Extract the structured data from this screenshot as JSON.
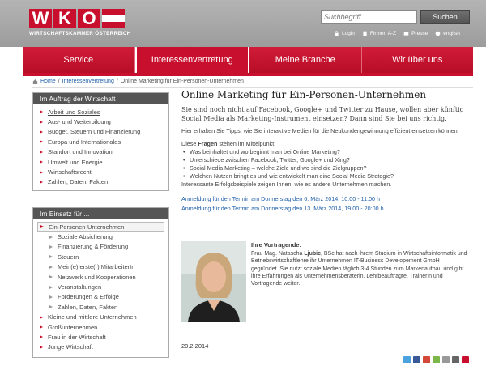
{
  "header": {
    "logo_letters": [
      "W",
      "K",
      "O"
    ],
    "logo_subtitle": "WIRTSCHAFTSKAMMER ÖSTERREICH",
    "search_placeholder": "Suchbegriff",
    "search_button": "Suchen",
    "util_links": [
      {
        "label": "Login",
        "icon": "lock-icon"
      },
      {
        "label": "Firmen A-Z",
        "icon": "building-icon"
      },
      {
        "label": "Presse",
        "icon": "newspaper-icon"
      },
      {
        "label": "english",
        "icon": "globe-icon"
      }
    ],
    "colors": {
      "brand_red": "#c8102e",
      "header_grey": "#a8a8a8"
    }
  },
  "nav": {
    "items": [
      "Service",
      "Interessenvertretung",
      "Meine Branche",
      "Wir über uns"
    ],
    "active_index": 1
  },
  "breadcrumb": {
    "items": [
      "Home",
      "Interessenvertretung",
      "Online Marketing für Ein-Personen-Unternehmen"
    ],
    "separator": "/"
  },
  "sidebar": {
    "box1": {
      "title": "Im Auftrag der Wirtschaft",
      "items": [
        "Arbeit und Soziales",
        "Aus- und Weiterbildung",
        "Budget, Steuern und Finanzierung",
        "Europa und Internationales",
        "Standort und Innovation",
        "Umwelt und Energie",
        "Wirtschaftsrecht",
        "Zahlen, Daten, Fakten"
      ]
    },
    "box2": {
      "title": "Im Einsatz für ...",
      "active": "Ein-Personen-Unternehmen",
      "subitems": [
        "Soziale Absicherung",
        "Finanzierung & Förderung",
        "Steuern",
        "Mein(e) erste(r) MitarbeiterIn",
        "Netzwerk und Kooperationen",
        "Veranstaltungen",
        "Förderungen & Erfolge",
        "Zahlen, Daten, Fakten"
      ],
      "items": [
        "Kleine und mittlere Unternehmen",
        "Großunternehmen",
        "Frau in der Wirtschaft",
        "Junge Wirtschaft"
      ]
    }
  },
  "main": {
    "title": "Online Marketing für Ein-Personen-Unternehmen",
    "lead": "Sie sind noch nicht auf Facebook, Google+ und Twitter zu Hause, wollen aber künftig Social Media als Marketing-Instrument einsetzen? Dann sind Sie bei uns richtig.",
    "para1": "Hier erhalten Sie Tipps, wie Sie interaktive Medien für die Neukundengewinnung effizient einsetzen können.",
    "questions_intro_prefix": "Diese ",
    "questions_intro_bold": "Fragen",
    "questions_intro_suffix": " stehen im Mittelpunkt:",
    "questions": [
      "Was beinhaltet und wo beginnt man bei Online Marketing?",
      "Unterschiede zwischen Facebook, Twitter, Google+ und Xing?",
      "Social Media Marketing – welche Ziele und wo sind die Zielgruppen?",
      "Welchen Nutzen bringt es und wie entwickelt man eine Social Media Strategie?"
    ],
    "after_questions": "Interessante Erfolgsbeispiele zeigen Ihnen, wie es andere Unternehmen machen.",
    "registration_links": [
      "Anmeldung für den Termin am Donnerstag den 6. März 2014, 10:00 - 11:00 h",
      "Anmeldung für den Termin am Donnerstag den 13. März 2014, 19:00 - 20:00 h"
    ],
    "speaker_heading": "Ihre Vortragende:",
    "speaker_bio_prefix": "Frau Mag. Natascha ",
    "speaker_name_bold": "Ljubic",
    "speaker_bio_suffix": ", BSc hat nach ihrem Studium in Wirtschaftsinformatik und Betriebswirtschaftlehre ihr Unternehmen IT-Business Developement GmbH gegründet. Sie nutzt soziale Medien täglich 3-4 Stunden zum Markenaufbau und gibt ihre Erfahrungen als Unternehmensberaterin, Lehrbeauftragte, Trainerin und Vortragende weiter.",
    "date": "20.2.2014"
  },
  "share_icons": [
    "twitter-icon",
    "facebook-icon",
    "googleplus-icon",
    "share-icon",
    "email-icon",
    "print-icon",
    "bookmark-icon"
  ]
}
